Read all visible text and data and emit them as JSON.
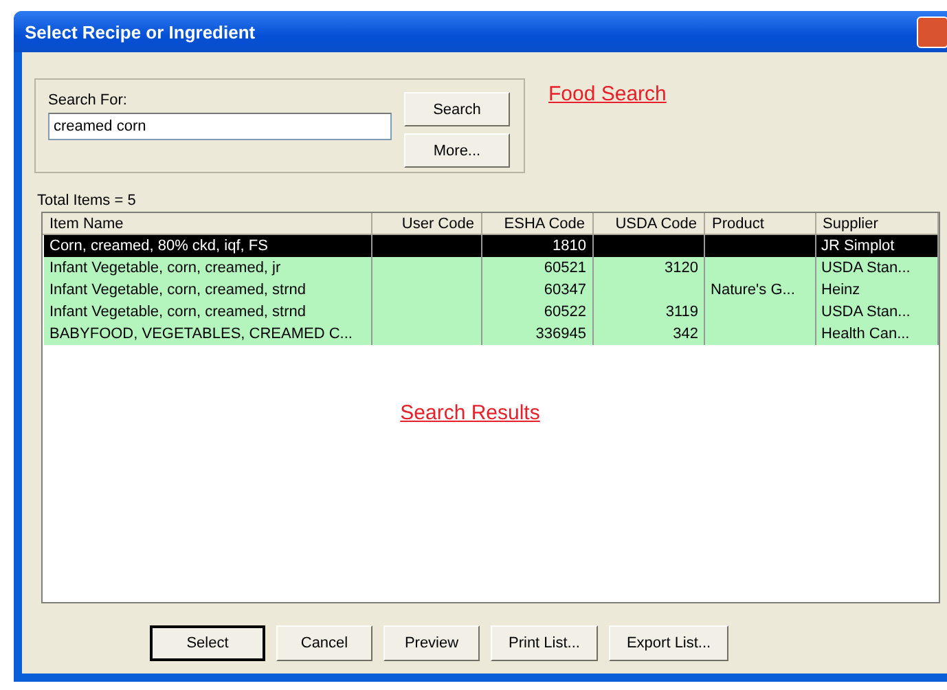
{
  "window": {
    "title": "Select Recipe or Ingredient"
  },
  "search": {
    "label": "Search For:",
    "value": "creamed corn",
    "buttons": [
      "Search",
      "More..."
    ]
  },
  "annotations": {
    "top": "Food Search",
    "middle": "Search Results"
  },
  "total": "Total Items = 5",
  "table": {
    "columns": [
      "Item Name",
      "User Code",
      "ESHA Code",
      "USDA Code",
      "Product",
      "Supplier"
    ],
    "rows": [
      {
        "selected": true,
        "cells": [
          "Corn, creamed, 80% ckd, iqf, FS",
          "",
          "1810",
          "",
          "",
          "JR Simplot"
        ]
      },
      {
        "selected": false,
        "cells": [
          "Infant Vegetable, corn, creamed, jr",
          "",
          "60521",
          "3120",
          "",
          "USDA Stan..."
        ]
      },
      {
        "selected": false,
        "cells": [
          "Infant Vegetable, corn, creamed, strnd",
          "",
          "60347",
          "",
          "Nature's G...",
          "Heinz"
        ]
      },
      {
        "selected": false,
        "cells": [
          "Infant Vegetable, corn, creamed, strnd",
          "",
          "60522",
          "3119",
          "",
          "USDA Stan..."
        ]
      },
      {
        "selected": false,
        "cells": [
          "BABYFOOD, VEGETABLES, CREAMED C...",
          "",
          "336945",
          "342",
          "",
          "Health Can..."
        ]
      }
    ]
  },
  "buttons": [
    {
      "label": "Select",
      "default": true
    },
    {
      "label": "Cancel",
      "default": false
    },
    {
      "label": "Preview",
      "default": false
    },
    {
      "label": "Print List...",
      "default": false
    },
    {
      "label": "Export List...",
      "default": false
    }
  ]
}
